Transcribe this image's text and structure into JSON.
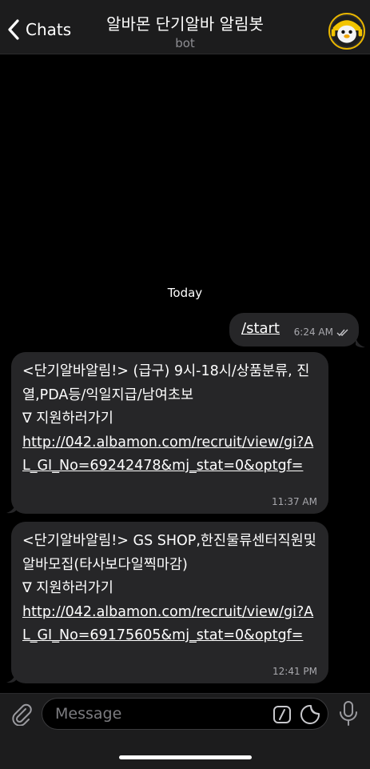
{
  "header": {
    "back_label": "Chats",
    "title": "알바몬 단기알바 알림봇",
    "subtitle": "bot",
    "avatar_icon": "penguin-avatar-icon"
  },
  "date_separator": "Today",
  "messages": [
    {
      "direction": "outgoing",
      "text": "/start",
      "time": "6:24 AM",
      "status": "read"
    },
    {
      "direction": "incoming",
      "line1": "<단기알바알림!> (급구) 9시-18시/상품분류, 진열,PDA등/익일지급/남여초보",
      "line2": "∇ 지원하러가기",
      "link": "http://042.albamon.com/recruit/view/gi?AL_GI_No=69242478&mj_stat=0&optgf=",
      "time": "11:37 AM"
    },
    {
      "direction": "incoming",
      "line1": "<단기알바알림!> GS SHOP,한진물류센터직원및알바모집(타사보다일찍마감)",
      "line2": "∇ 지원하러가기",
      "link": "http://042.albamon.com/recruit/view/gi?AL_GI_No=69175605&mj_stat=0&optgf=",
      "time": "12:41 PM"
    }
  ],
  "composer": {
    "placeholder": "Message",
    "icons": [
      "paperclip-icon",
      "bot-command-icon",
      "sticker-icon",
      "microphone-icon"
    ]
  },
  "colors": {
    "background": "#000000",
    "bar": "#1c1c1d",
    "bubble": "#262628",
    "meta_text": "#a8a8ad",
    "avatar_ring": "#e8b500"
  }
}
